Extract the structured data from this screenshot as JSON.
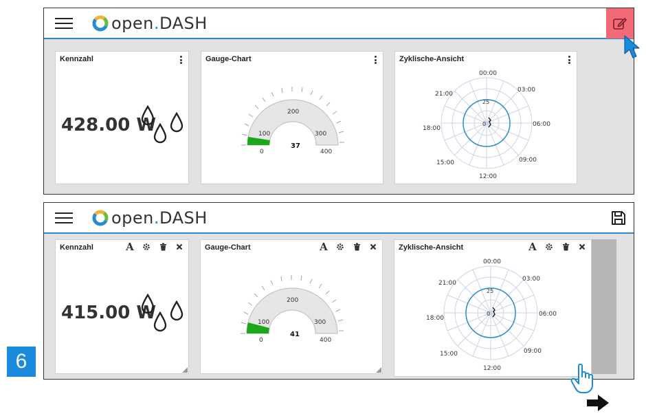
{
  "app": {
    "brand_prefix": "open",
    "brand_dot": ".",
    "brand_suffix": "DASH"
  },
  "colors": {
    "accent": "#2a8ad0",
    "edit_button_bg": "#f26a76",
    "gauge_fill": "#1aa81a",
    "polar_line": "#2a8ad0",
    "step_badge": "#1a8adc"
  },
  "icons": {
    "menu": "hamburger-menu-icon",
    "edit": "edit-icon",
    "save": "save-icon",
    "kebab": "kebab-menu-icon",
    "font": "font-icon",
    "settings": "gear-icon",
    "delete": "trash-icon",
    "close": "close-icon",
    "drops": "water-drops-icon",
    "cursor": "mouse-pointer-icon",
    "hand": "hand-pointer-icon",
    "arrow": "arrow-right-icon"
  },
  "top_dashboard": {
    "kennzahl": {
      "title": "Kennzahl",
      "value": "428.00 W"
    },
    "gauge": {
      "title": "Gauge-Chart",
      "value": "37",
      "ticks": [
        "0",
        "100",
        "200",
        "300",
        "400"
      ]
    },
    "cyclic": {
      "title": "Zyklische-Ansicht",
      "hours": [
        "00:00",
        "03:00",
        "06:00",
        "09:00",
        "12:00",
        "15:00",
        "18:00",
        "21:00"
      ],
      "ring_labels": [
        "25",
        "0"
      ]
    }
  },
  "bottom_dashboard": {
    "toolbar": {
      "font_glyph": "A"
    },
    "kennzahl": {
      "title": "Kennzahl",
      "value": "415.00 W"
    },
    "gauge": {
      "title": "Gauge-Chart",
      "value": "41",
      "ticks": [
        "0",
        "100",
        "200",
        "300",
        "400"
      ]
    },
    "cyclic": {
      "title": "Zyklische-Ansicht",
      "hours": [
        "00:00",
        "03:00",
        "06:00",
        "09:00",
        "12:00",
        "15:00",
        "18:00",
        "21:00"
      ],
      "ring_labels": [
        "25",
        "0"
      ]
    }
  },
  "step_number": "6"
}
